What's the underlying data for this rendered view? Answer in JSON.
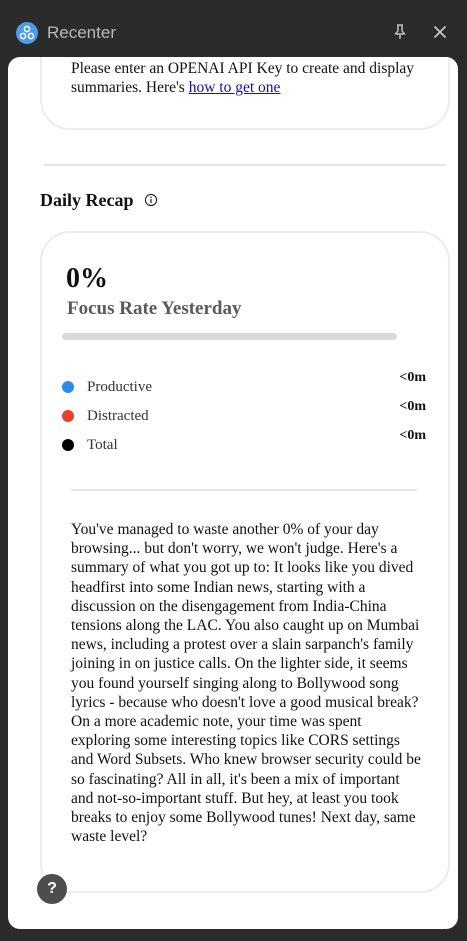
{
  "window": {
    "title": "Recenter",
    "logo_icon": "recenter-logo-icon",
    "pin_icon": "pin-icon",
    "close_icon": "close-icon"
  },
  "api_notice": {
    "text": "Please enter an OPENAI API Key to create and display summaries. Here's ",
    "link_text": "how to get one"
  },
  "daily_recap": {
    "title": "Daily Recap",
    "info_icon": "info-icon",
    "focus_rate_value": "0%",
    "focus_rate_label": "Focus Rate Yesterday",
    "focus_rate_fraction": 0,
    "stats": [
      {
        "label": "Productive",
        "value": "<0m",
        "color": "#2d8cea"
      },
      {
        "label": "Distracted",
        "value": "<0m",
        "color": "#e8402f"
      },
      {
        "label": "Total",
        "value": "<0m",
        "color": "#000000"
      }
    ],
    "summary": "You've managed to waste another 0% of your day browsing... but don't worry, we won't judge. Here's a summary of what you got up to: It looks like you dived headfirst into some Indian news, starting with a discussion on the disengagement from India-China tensions along the LAC. You also caught up on Mumbai news, including a protest over a slain sarpanch's family joining in on justice calls. On the lighter side, it seems you found yourself singing along to Bollywood song lyrics - because who doesn't love a good musical break? On a more academic note, your time was spent exploring some interesting topics like CORS settings and Word Subsets. Who knew browser security could be so fascinating? All in all, it's been a mix of important and not-so-important stuff. But hey, at least you took breaks to enjoy some Bollywood tunes! Next day, same waste level?"
  },
  "help": {
    "label": "?"
  }
}
